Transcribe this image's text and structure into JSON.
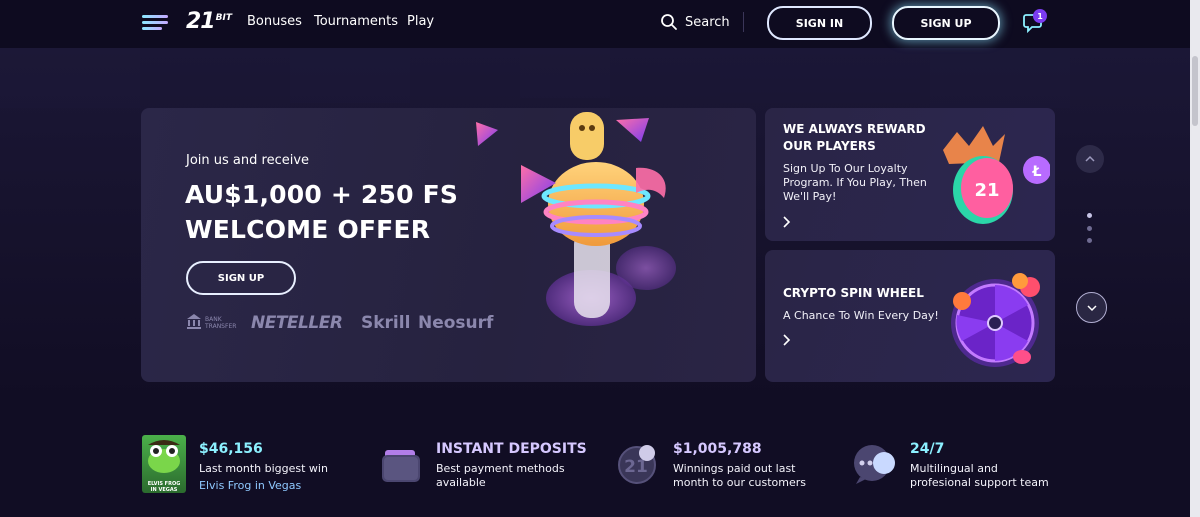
{
  "header": {
    "logo_number": "21",
    "logo_suffix": "BIT",
    "nav": [
      "Bonuses",
      "Tournaments",
      "Play"
    ],
    "search_label": "Search",
    "sign_in_label": "SIGN IN",
    "sign_up_label": "SIGN UP",
    "notification_count": "1"
  },
  "banner": {
    "intro": "Join us and receive",
    "headline_line1": "AU$1,000 + 250 FS",
    "headline_line2": "WELCOME OFFER",
    "cta_label": "SIGN UP",
    "payment_methods": {
      "bank_label_line1": "BANK",
      "bank_label_line2": "TRANSFER",
      "neteller": "NETELLER",
      "skrill": "Skrill",
      "neosurf": "Neosurf"
    }
  },
  "cards": [
    {
      "title_line1": "WE ALWAYS REWARD",
      "title_line2": "OUR PLAYERS",
      "text_line1": "Sign Up To Our Loyalty",
      "text_line2": "Program. If You Play, Then",
      "text_line3": "We'll Pay!",
      "badge_text": "21"
    },
    {
      "title_line1": "CRYPTO SPIN WHEEL",
      "text_line1": "A Chance To Win Every Day!"
    }
  ],
  "stats": [
    {
      "value": "$46,156",
      "text_line1": "Last month biggest win",
      "sub": "Elvis Frog in Vegas",
      "thumb_caption_line1": "ELVIS FROG",
      "thumb_caption_line2": "IN VEGAS"
    },
    {
      "value": "INSTANT DEPOSITS",
      "text_line1": "Best payment methods",
      "text_line2": "available"
    },
    {
      "value": "$1,005,788",
      "text_line1": "Winnings paid out last",
      "text_line2": "month to our customers"
    },
    {
      "value": "24/7",
      "text_line1": "Multilingual and",
      "text_line2": "profesional support team"
    }
  ],
  "colors": {
    "background": "#110d24",
    "card": "#2a2546",
    "accent_teal": "#8cf0ff",
    "accent_purple": "#7b3cf0"
  }
}
